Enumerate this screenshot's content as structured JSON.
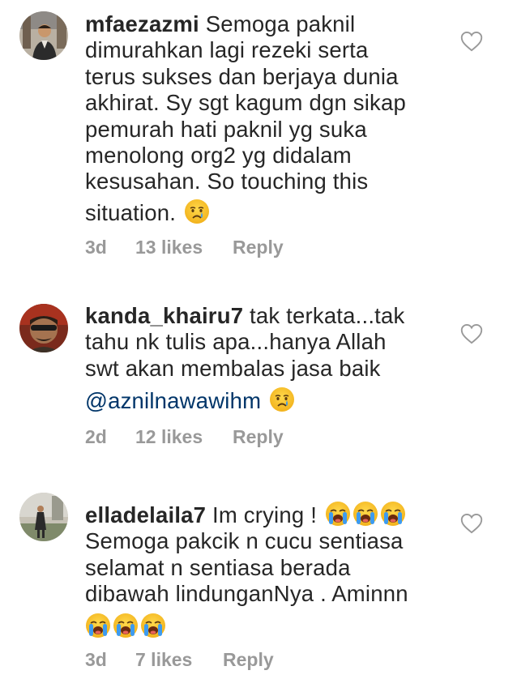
{
  "comments": [
    {
      "username": "mfaezazmi",
      "lines": [
        "Semoga paknil",
        "dimurahkan lagi rezeki serta",
        "terus sukses dan berjaya dunia",
        "akhirat. Sy sgt kagum dgn sikap",
        "pemurah hati paknil yg suka",
        "menolong org2 yg didalam",
        "kesusahan. So touching this",
        "situation."
      ],
      "trailing_emoji": [
        "crying-face"
      ],
      "time": "3d",
      "likes": "13 likes",
      "reply": "Reply"
    },
    {
      "username": "kanda_khairu7",
      "lines": [
        "tak terkata...tak",
        "tahu nk tulis apa...hanya Allah",
        "swt akan membalas jasa baik"
      ],
      "mention": "@aznilnawawihm",
      "trailing_emoji": [
        "crying-face"
      ],
      "time": "2d",
      "likes": "12 likes",
      "reply": "Reply"
    },
    {
      "username": "elladelaila7",
      "lines": [
        "Im crying !",
        "Semoga pakcik n cucu sentiasa",
        "selamat n sentiasa berada",
        "dibawah lindunganNya . Aminnn"
      ],
      "emoji_line1": [
        "loudly-crying-face",
        "loudly-crying-face",
        "loudly-crying-face"
      ],
      "trailing_emoji": [
        "loudly-crying-face",
        "loudly-crying-face",
        "loudly-crying-face"
      ],
      "time": "3d",
      "likes": "7 likes",
      "reply": "Reply"
    }
  ],
  "colors": {
    "text": "#262626",
    "meta": "#999999",
    "mention": "#003569",
    "emoji_yellow": "#f7c22f",
    "tear_blue": "#3d9bf0"
  },
  "icons": [
    "heart-outline-icon",
    "crying-face-emoji",
    "loudly-crying-face-emoji"
  ]
}
